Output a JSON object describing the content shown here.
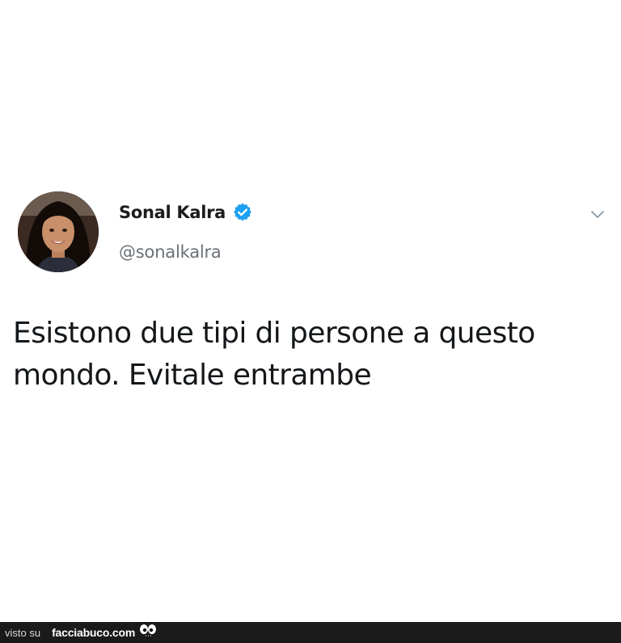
{
  "tweet": {
    "display_name": "Sonal Kalra",
    "handle": "@sonalkalra",
    "verified": true,
    "text": "Esistono due tipi di persone a questo mondo. Evitale entrambe",
    "icons": {
      "avatar": "profile-photo",
      "verified": "verified-badge-icon",
      "menu": "chevron-down-icon"
    }
  },
  "footer": {
    "prefix": "visto su",
    "brand": "facciabuco.com",
    "logo": "eyes-logo"
  },
  "colors": {
    "verified_blue": "#1da1f2",
    "text": "#14171a",
    "secondary_text": "#6b7176",
    "footer_bg": "#1a1a1a"
  }
}
